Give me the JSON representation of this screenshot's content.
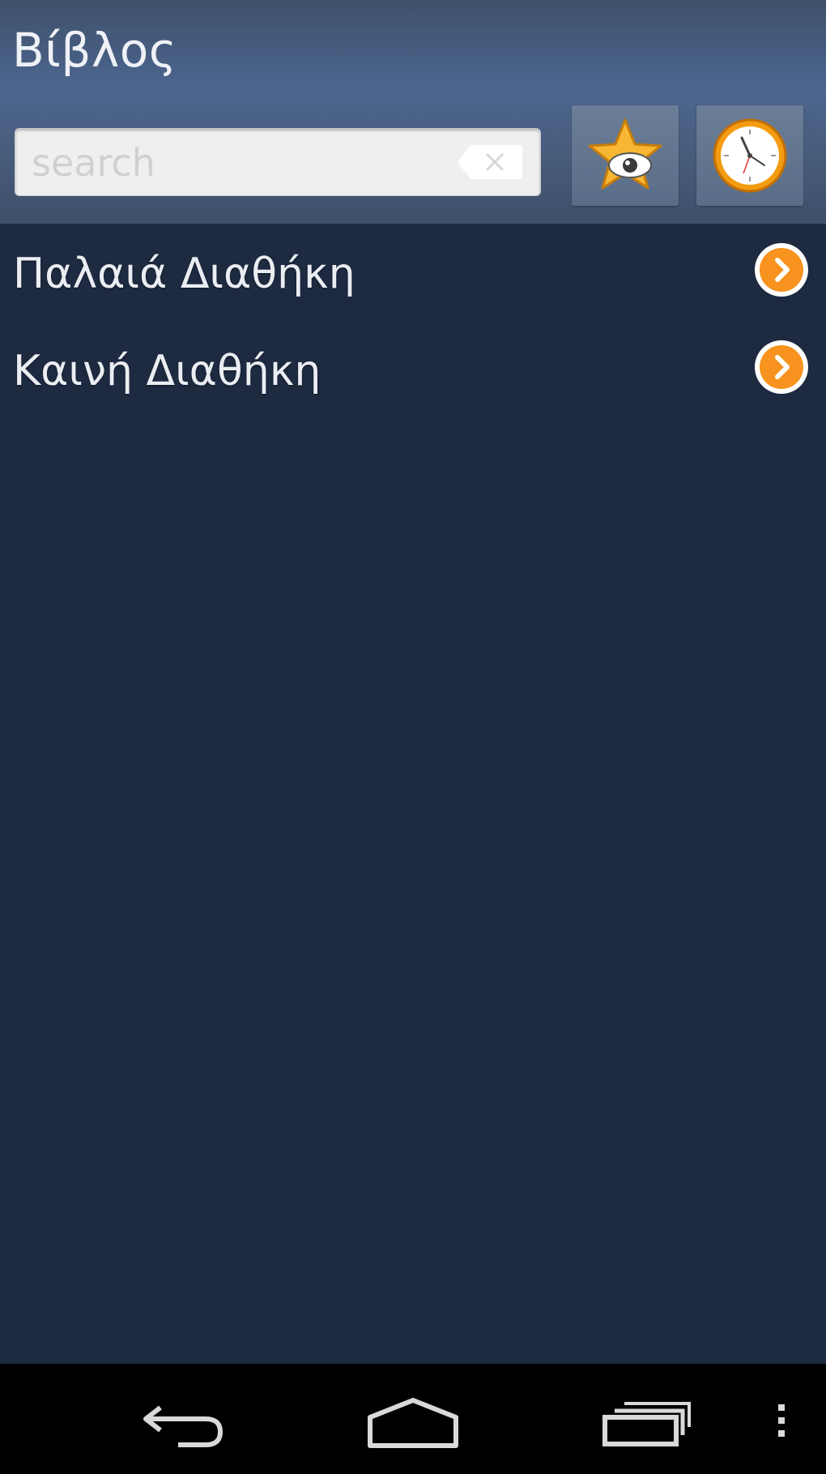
{
  "app": {
    "title": "Βίβλος"
  },
  "search": {
    "placeholder": "search",
    "value": ""
  },
  "toolbar": {
    "favorites_icon": "star-eye-icon",
    "history_icon": "clock-icon"
  },
  "list": {
    "items": [
      {
        "label": "Παλαιά Διαθήκη",
        "icon": "chevron-right-circle-icon"
      },
      {
        "label": "Καινή Διαθήκη",
        "icon": "chevron-right-circle-icon"
      }
    ]
  },
  "colors": {
    "background": "#1d2a40",
    "header": "#4c6690",
    "accent": "#f7931e"
  },
  "navbar": {
    "back_icon": "back-icon",
    "home_icon": "home-icon",
    "recents_icon": "recents-icon",
    "menu_icon": "overflow-menu-icon"
  }
}
